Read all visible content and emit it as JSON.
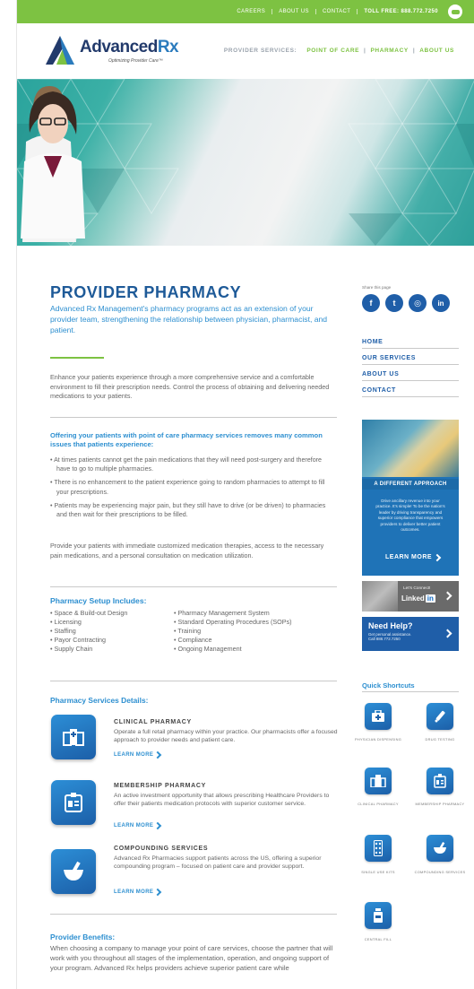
{
  "topbar": {
    "links": [
      "CAREERS",
      "ABOUT US",
      "CONTACT"
    ],
    "phone": "TOLL FREE: 888.772.7250"
  },
  "header": {
    "logo_word_a": "Advanced",
    "logo_word_b": "Rx",
    "logo_tagline": "Optimizing Provider Care™",
    "nav_label": "PROVIDER SERVICES:",
    "nav_items": [
      "POINT OF CARE",
      "PHARMACY",
      "ABOUT US"
    ]
  },
  "main": {
    "title": "PROVIDER PHARMACY",
    "lead": "Advanced Rx Management's pharmacy programs act as an extension of your provider team, strengthening the relationship between physician, pharmacist, and patient.",
    "intro": "Enhance your patients experience through a more comprehensive service and a comfortable environment to fill their prescription needs. Control the process of obtaining and delivering needed medications to your patients.",
    "issues_head": "Offering your patients with point of care pharmacy services removes many common issues that patients experience:",
    "issues": [
      "• At times patients cannot get the pain medications that they will need post-surgery and therefore have to go to multiple pharmacies.",
      "• There is no enhancement to the patient experience going to random pharmacies to attempt to fill your prescriptions.",
      "• Patients may be experiencing major pain, but they still have to drive (or be driven) to pharmacies and then wait for their prescriptions to be filled."
    ],
    "provide": "Provide your patients with immediate customized medication therapies, access to the necessary pain medications, and a personal consultation on medication utilization.",
    "setup_head": "Pharmacy Setup Includes:",
    "setup_left": [
      "• Space & Build-out Design",
      "• Licensing",
      "• Staffing",
      "• Payor Contracting",
      "• Supply Chain"
    ],
    "setup_right": [
      "• Pharmacy Management System",
      "• Standard Operating Procedures (SOPs)",
      "• Training",
      "• Compliance",
      "• Ongoing Management"
    ],
    "services_head": "Pharmacy Services Details:",
    "services": [
      {
        "title": "CLINICAL PHARMACY",
        "desc": "Operate a full retail pharmacy within your practice. Our pharmacists offer a focused approach to provider needs and patient care.",
        "link": "LEARN MORE"
      },
      {
        "title": "MEMBERSHIP PHARMACY",
        "desc": "An active investment opportunity that allows prescribing Healthcare Providers to offer their patients medication protocols with superior customer service.",
        "link": "LEARN MORE"
      },
      {
        "title": "COMPOUNDING SERVICES",
        "desc": "Advanced Rx Pharmacies support patients across the US, offering a superior compounding program – focused on patient care and provider support.",
        "link": "LEARN MORE"
      }
    ],
    "benefits_head": "Provider Benefits:",
    "benefits": "When choosing a company to manage your point of care services, choose the partner that will work with you throughout all stages of the implementation, operation, and ongoing support of your program. Advanced Rx helps providers achieve superior patient care while"
  },
  "sidebar": {
    "share_label": "Share this page",
    "social": [
      "f",
      "t",
      "◎",
      "in"
    ],
    "nav": [
      "HOME",
      "OUR SERVICES",
      "ABOUT US",
      "CONTACT"
    ],
    "promo_title": "A DIFFERENT APPROACH",
    "promo_text": "Drive ancillary revenue into your practice. It's simple! To be the nation's leader by driving transparency and superior compliance that empowers providers to deliver better patient outcomes.",
    "promo_link": "LEARN MORE",
    "linkedin_text": "Let's Connect!",
    "linkedin_brand": "Linked",
    "linkedin_in": "in",
    "help_title": "Need Help?",
    "help_sub1": "Get personal assistance.",
    "help_sub2": "Call 888.772.7250",
    "qs_head": "Quick Shortcuts",
    "shortcuts": [
      {
        "label": "PHYSICIAN DISPENSING",
        "icon": "medical-kit"
      },
      {
        "label": "DRUG TESTING",
        "icon": "dropper"
      },
      {
        "label": "CLINICAL PHARMACY",
        "icon": "building"
      },
      {
        "label": "MEMBERSHIP PHARMACY",
        "icon": "id-badge"
      },
      {
        "label": "SINGLE USE KITS",
        "icon": "pill-pack"
      },
      {
        "label": "COMPOUNDING SERVICES",
        "icon": "mortar-pestle"
      },
      {
        "label": "CENTRAL FILL",
        "icon": "bottle"
      }
    ]
  },
  "colors": {
    "green": "#7dc242",
    "blue": "#1f5ea8",
    "light_blue": "#2d8fd0",
    "navy": "#223a6b"
  }
}
